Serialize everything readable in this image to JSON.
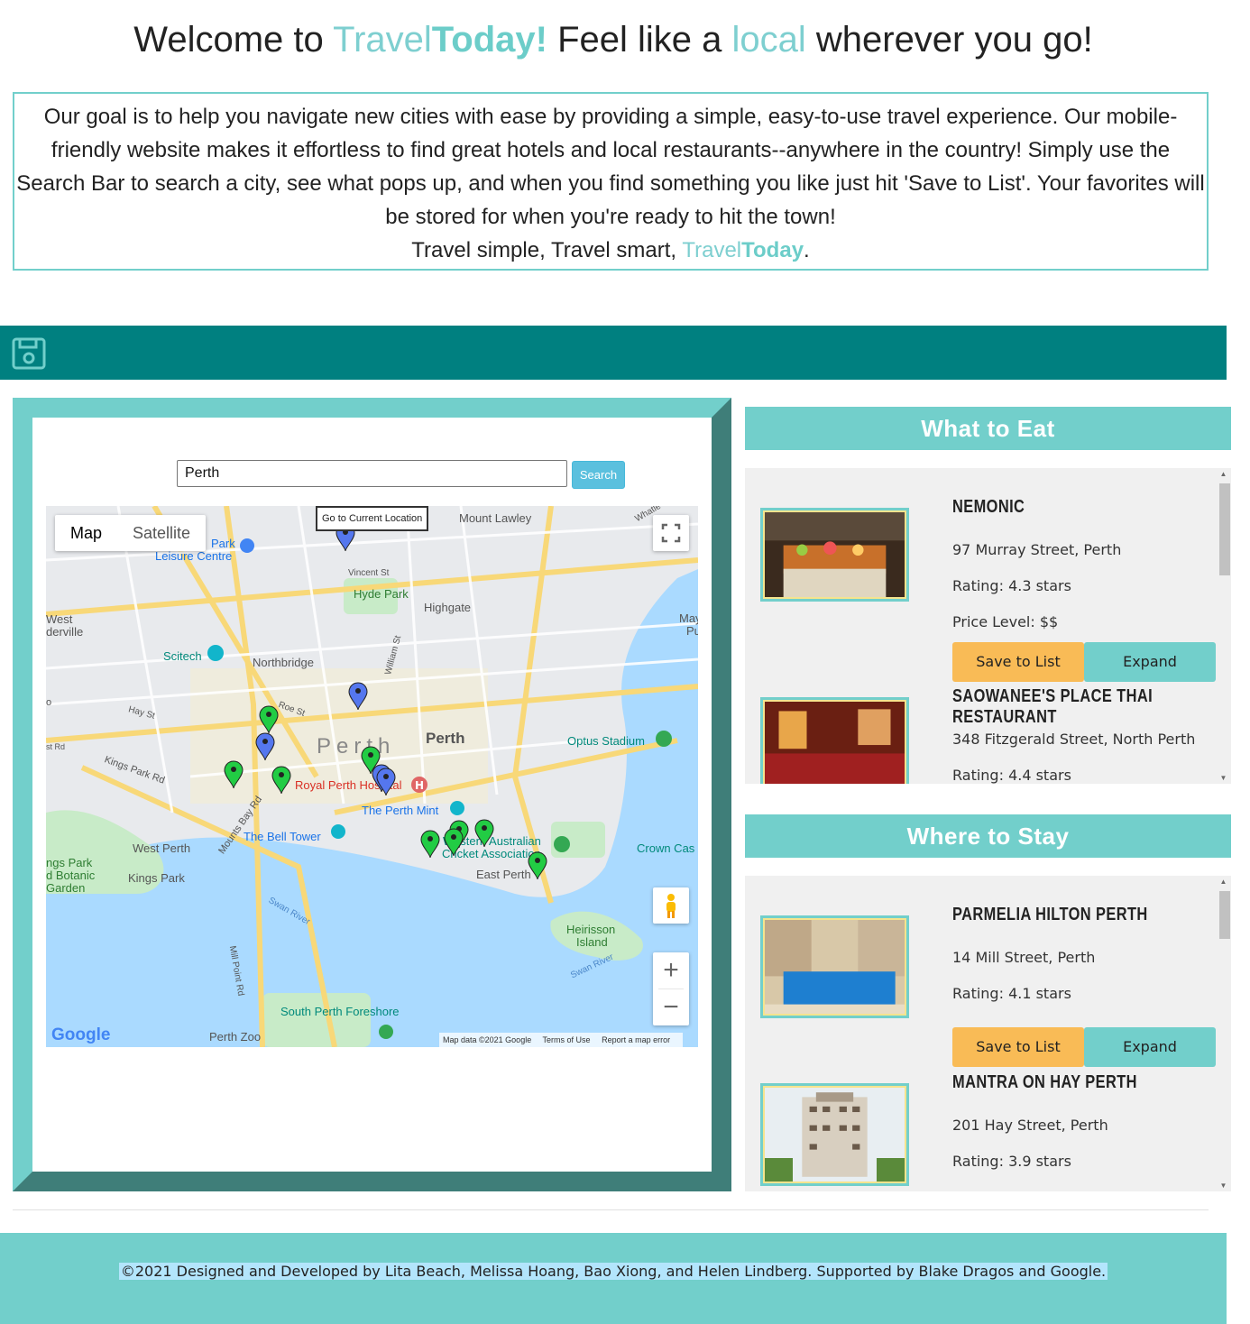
{
  "header": {
    "welcome_prefix": "Welcome to ",
    "brand_light": "Travel",
    "brand_bold": "Today!",
    "welcome_mid": " Feel like a ",
    "local_word": "local",
    "welcome_suffix": " wherever you go!"
  },
  "intro": {
    "body": "Our goal is to help you navigate new cities with ease by providing a simple, easy-to-use travel experience. Our mobile-friendly website makes it effortless to find great hotels and local restaurants--anywhere in the country! Simply use the Search Bar to search a city, see what pops up, and when you find something you like just hit 'Save to List'. Your favorites will be stored for when you're ready to hit the town!",
    "tagline_prefix": "Travel simple, Travel smart, ",
    "brand_light": "Travel",
    "brand_bold": "Today",
    "tagline_suffix": "."
  },
  "savebar": {
    "icon": "floppy-disk-icon"
  },
  "search": {
    "value": "Perth",
    "button_label": "Search"
  },
  "map": {
    "type_map": "Map",
    "type_satellite": "Satellite",
    "tooltip": "Go to Current Location",
    "zoom_in": "+",
    "zoom_out": "−",
    "logo": "Google",
    "map_data": "Map data ©2021 Google",
    "terms": "Terms of Use",
    "report": "Report a map error",
    "labels": [
      "Mount Lawley",
      "Park",
      "Leisure Centre",
      "Vincent St",
      "Hyde Park",
      "Highgate",
      "West",
      "derville",
      "Scitech",
      "Northbridge",
      "William St",
      "Hay St",
      "Roe St",
      "Perth",
      "Perth",
      "Optus Stadium",
      "Kings Park Rd",
      "Royal Perth Hospital",
      "The Perth Mint",
      "The Bell Tower",
      "Mounts Bay Rd",
      "West Perth",
      "Western Australian",
      "Cricket Association",
      "Crown Cas",
      "ngs Park",
      "d Botanic",
      "Garden",
      "Kings Park",
      "East Perth",
      "Swan River",
      "Heirisson",
      "Island",
      "Swan River",
      "Mill Point Rd",
      "South Perth Foreshore",
      "Perth Zoo",
      "May",
      "Pu",
      "Whatle",
      "o",
      "st Rd"
    ]
  },
  "eat": {
    "title": "What to Eat",
    "items": [
      {
        "name": "NEMONIC",
        "address": "97 Murray Street, Perth",
        "rating": "Rating: 4.3 stars",
        "price": "Price Level: $$",
        "save_label": "Save to List",
        "expand_label": "Expand"
      },
      {
        "name": "SAOWANEE'S PLACE THAI RESTAURANT",
        "address": "348 Fitzgerald Street, North Perth",
        "rating": "Rating: 4.4 stars"
      }
    ]
  },
  "stay": {
    "title": "Where to Stay",
    "items": [
      {
        "name": "PARMELIA HILTON PERTH",
        "address": "14 Mill Street, Perth",
        "rating": "Rating: 4.1 stars",
        "save_label": "Save to List",
        "expand_label": "Expand"
      },
      {
        "name": "MANTRA ON HAY PERTH",
        "address": "201 Hay Street, Perth",
        "rating": "Rating: 3.9 stars"
      }
    ]
  },
  "footer": {
    "text": "©2021 Designed and Developed by Lita Beach, Melissa Hoang, Bao Xiong, and Helen Lindberg. Supported by Blake Dragos and Google."
  },
  "colors": {
    "teal_dark": "#008080",
    "teal_light": "#72cfcb",
    "save_button": "#f9bb56",
    "marker_green": "#22cc44",
    "marker_blue": "#5577ee"
  }
}
